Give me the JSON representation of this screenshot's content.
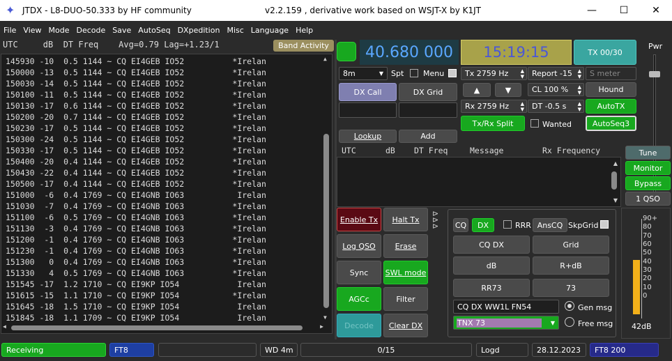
{
  "window": {
    "title": "JTDX - L8-DUO-50.333  by HF community",
    "subtitle": "v2.2.159 , derivative work based on WSJT-X by K1JT"
  },
  "menu": [
    "File",
    "View",
    "Mode",
    "Decode",
    "Save",
    "AutoSeq",
    "DXpedition",
    "Misc",
    "Language",
    "Help"
  ],
  "decode": {
    "header": "UTC     dB  DT Freq    Avg=0.79 Lag=+1.23/1",
    "band_activity": "Band Activity",
    "rows": [
      "145930 -10  0.5 1144 ~ CQ EI4GEB IO52          *Irelan",
      "150000 -13  0.5 1144 ~ CQ EI4GEB IO52          *Irelan",
      "150030 -14  0.5 1144 ~ CQ EI4GEB IO52          *Irelan",
      "150100 -11  0.5 1144 ~ CQ EI4GEB IO52          *Irelan",
      "150130 -17  0.6 1144 ~ CQ EI4GEB IO52          *Irelan",
      "150200 -20  0.7 1144 ~ CQ EI4GEB IO52          *Irelan",
      "150230 -17  0.5 1144 ~ CQ EI4GEB IO52          *Irelan",
      "150300 -24  0.5 1144 ~ CQ EI4GEB IO52          *Irelan",
      "150330 -17  0.5 1144 ~ CQ EI4GEB IO52          *Irelan",
      "150400 -20  0.4 1144 ~ CQ EI4GEB IO52          *Irelan",
      "150430 -22  0.4 1144 ~ CQ EI4GEB IO52          *Irelan",
      "150500 -17  0.4 1144 ~ CQ EI4GEB IO52          *Irelan",
      "151000  -6  0.4 1769 ~ CQ EI4GNB IO63           Irelan",
      "151030  -7  0.4 1769 ~ CQ EI4GNB IO63          *Irelan",
      "151100  -6  0.5 1769 ~ CQ EI4GNB IO63          *Irelan",
      "151130  -3  0.4 1769 ~ CQ EI4GNB IO63          *Irelan",
      "151200  -1  0.4 1769 ~ CQ EI4GNB IO63          *Irelan",
      "151230  -1  0.4 1769 ~ CQ EI4GNB IO63          *Irelan",
      "151300   0  0.4 1769 ~ CQ EI4GNB IO63          *Irelan",
      "151330   4  0.5 1769 ~ CQ EI4GNB IO63          *Irelan",
      "151545 -17  1.2 1710 ~ CQ EI9KP IO54            Irelan",
      "151615 -15  1.1 1710 ~ CQ EI9KP IO54           *Irelan",
      "151645 -18  1.5 1710 ~ CQ EI9KP IO54            Irelan",
      "151845 -18  1.1 1709 ~ CQ EI9KP IO54            Irelan"
    ]
  },
  "top": {
    "frequency": "40.680 000",
    "time": "15:19:15",
    "tx_counter": "TX 00/30",
    "band": "8m",
    "spt": "Spt",
    "menu_label": "Menu",
    "tx_hz": "Tx  2759  Hz",
    "rx_hz": "Rx  2759  Hz",
    "report": "Report -15",
    "smeter_placeholder": "S meter",
    "cl": "CL  100 %",
    "dt": "DT  -0.5 s",
    "hound": "Hound",
    "autotx": "AutoTX",
    "autoseq3": "AutoSeq3",
    "txrx_split": "Tx/Rx Split",
    "wanted": "Wanted",
    "dx_call": "DX Call",
    "dx_grid": "DX Grid",
    "lookup": "Lookup",
    "add": "Add",
    "pwr": "Pwr"
  },
  "rx_header": {
    "utc": "UTC",
    "db": "dB",
    "dt_freq": "DT  Freq",
    "message": "Message",
    "rx_freq": "Rx Frequency"
  },
  "right_buttons": {
    "tune": "Tune",
    "monitor": "Monitor",
    "bypass": "Bypass",
    "qso": "1 QSO"
  },
  "ctrl": {
    "enable_tx": "Enable Tx",
    "halt_tx": "Halt Tx",
    "log_qso": "Log QSO",
    "erase": "Erase",
    "sync": "Sync",
    "swl_mode": "SWL mode",
    "agcc": "AGCc",
    "filter": "Filter",
    "decode": "Decode",
    "clear_dx": "Clear DX"
  },
  "tx": {
    "cq": "CQ",
    "dx": "DX",
    "rrr": "RRR",
    "anscq": "AnsCQ",
    "skpgrid": "SkpGrid",
    "cq_dx": "CQ DX",
    "grid": "Grid",
    "db": "dB",
    "r_db": "R+dB",
    "rr73": "RR73",
    "s73": "73",
    "free_text": "CQ DX WW1L FN54",
    "gen_msg": "Gen msg",
    "tnx": "TNX 73",
    "free_msg": "Free msg"
  },
  "meter": {
    "ticks": [
      "90+",
      "80",
      "70",
      "60",
      "50",
      "40",
      "30",
      "20",
      "10",
      "0"
    ],
    "readout": "42dB",
    "level": 42
  },
  "status": {
    "receiving": "Receiving",
    "mode": "FT8",
    "wd": "WD 4m",
    "progress": "0/15",
    "logd": "Logd",
    "date": "28.12.2023",
    "mode_right": "FT8  200"
  },
  "colors": {
    "green": "#18a81f",
    "time_bg": "#a8a24a",
    "freq_text": "#5aa7ff",
    "tx_counter_bg": "#3aa6a0"
  }
}
